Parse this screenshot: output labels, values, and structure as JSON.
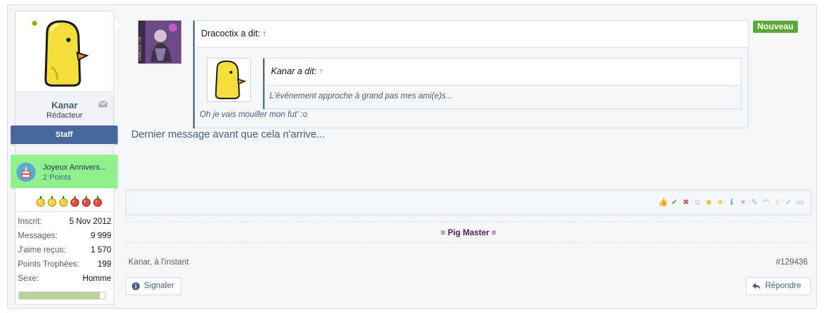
{
  "user": {
    "name": "Kanar",
    "title": "Rédacteur",
    "banner": "Staff",
    "online": true
  },
  "award": {
    "title": "Joyeux Annivers...",
    "points": "2 Points"
  },
  "medals": [
    "gold",
    "gold",
    "gold",
    "red",
    "red",
    "red"
  ],
  "stats": [
    {
      "label": "Inscrit:",
      "value": "5 Nov 2012"
    },
    {
      "label": "Messages:",
      "value": "9 999"
    },
    {
      "label": "J'aime reçus:",
      "value": "1 570"
    },
    {
      "label": "Points Trophées:",
      "value": "199"
    },
    {
      "label": "Sexe:",
      "value": "Homme"
    }
  ],
  "progress": 0.94,
  "badge": "Nouveau",
  "quote_outer": {
    "author": "Dracoctix a dit:",
    "arrow": "↑",
    "body": "Oh je vais mouiller mon fut' :o"
  },
  "quote_inner": {
    "author": "Kanar a dit:",
    "arrow": "↑",
    "body": "L'événement approche à grand pas mes ami(e)s..."
  },
  "message": "Dernier message avant que cela n'arrive...",
  "reactions": [
    "thumbs-up",
    "check",
    "cross",
    "face",
    "smile",
    "star",
    "info",
    "heart",
    "wrench",
    "rainbow",
    "brush",
    "spell-check",
    "box"
  ],
  "signature": "≡ Pig Master ≡",
  "footer": {
    "author_time": "Kanar, à l'instant",
    "post_number": "#129436",
    "report_label": "Signaler",
    "reply_label": "Répondre"
  },
  "colors": {
    "accent": "#47607e",
    "staff": "#47689c",
    "award_bg": "#92f18f",
    "new_badge": "#5aa839",
    "signature": "#5c1a5a"
  }
}
